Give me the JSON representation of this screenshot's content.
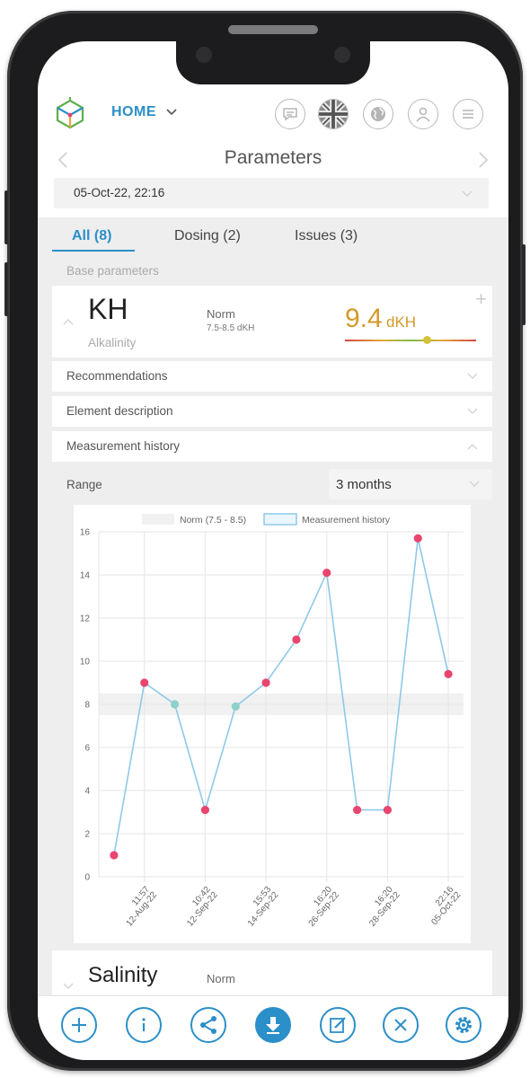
{
  "header": {
    "home_label": "HOME",
    "icons": [
      "chat-icon",
      "language-flag-icon",
      "globe-icon",
      "user-icon",
      "menu-icon"
    ]
  },
  "page": {
    "title": "Parameters",
    "date_value": "05-Oct-22, 22:16"
  },
  "tabs": [
    {
      "label": "All (8)",
      "active": true
    },
    {
      "label": "Dosing (2)",
      "active": false
    },
    {
      "label": "Issues (3)",
      "active": false
    }
  ],
  "section_label": "Base parameters",
  "kh": {
    "symbol": "KH",
    "name": "Alkalinity",
    "norm_label": "Norm",
    "norm_range": "7.5-8.5 dKH",
    "value": "9.4",
    "unit": "dKH",
    "value_color": "#d39a2b",
    "indicator_fraction": 0.63
  },
  "rows": {
    "recommendations": "Recommendations",
    "element_description": "Element description",
    "measurement_history": "Measurement history"
  },
  "range": {
    "label": "Range",
    "value": "3 months"
  },
  "chart_data": {
    "type": "line",
    "legend": [
      {
        "label": "Norm (7.5 - 8.5)"
      },
      {
        "label": "Measurement history"
      }
    ],
    "legend_position": "top",
    "ylim": [
      0,
      16
    ],
    "yticks": [
      0,
      2,
      4,
      6,
      8,
      10,
      12,
      14,
      16
    ],
    "norm_band": [
      7.5,
      8.5
    ],
    "xtick_labels": [
      {
        "time": "11:57",
        "date": "12-Aug-22"
      },
      {
        "time": "10:42",
        "date": "12-Sep-22"
      },
      {
        "time": "15:53",
        "date": "14-Sep-22"
      },
      {
        "time": "16:20",
        "date": "26-Sep-22"
      },
      {
        "time": "16:20",
        "date": "28-Sep-22"
      },
      {
        "time": "22:16",
        "date": "05-Oct-22"
      }
    ],
    "xtick_positions": [
      1,
      3,
      5,
      7,
      9,
      11
    ],
    "series": [
      {
        "name": "Measurement history",
        "values": [
          1,
          9,
          8,
          3.1,
          7.9,
          9,
          11,
          14.1,
          3.1,
          3.1,
          15.7,
          9.4
        ],
        "in_norm": [
          false,
          false,
          true,
          false,
          true,
          false,
          false,
          false,
          false,
          false,
          false,
          false
        ]
      }
    ],
    "colors": {
      "line": "#8ec9e8",
      "out_of_norm": "#e8456f",
      "in_norm": "#8fd1c8",
      "band": "#f1f1f1"
    },
    "grid": true
  },
  "salinity": {
    "symbol": "Salinity",
    "norm_label": "Norm"
  },
  "bottom_bar": {
    "icons": [
      "add-icon",
      "info-icon",
      "share-icon",
      "download-icon",
      "edit-icon",
      "close-icon",
      "settings-icon"
    ],
    "accent": "#2b8fc9"
  }
}
